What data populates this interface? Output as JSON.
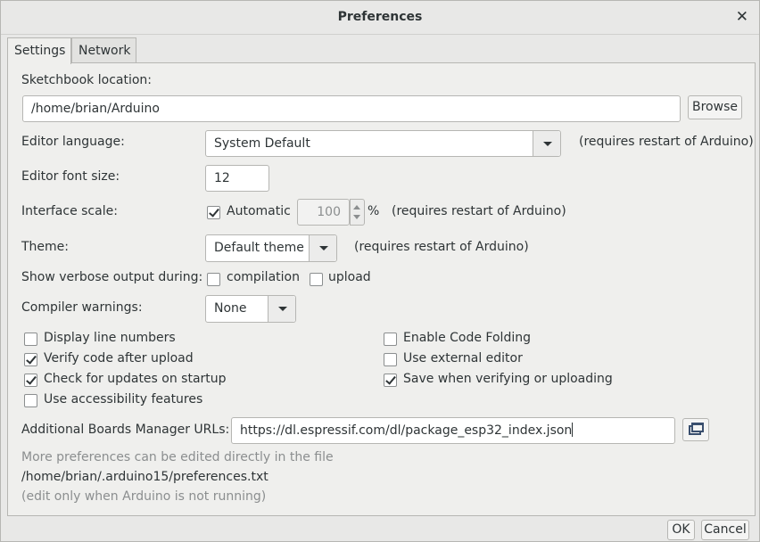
{
  "window": {
    "title": "Preferences"
  },
  "tabs": [
    {
      "label": "Settings",
      "active": true
    },
    {
      "label": "Network",
      "active": false
    }
  ],
  "settings": {
    "sketchbook": {
      "label": "Sketchbook location:",
      "value": "/home/brian/Arduino",
      "browse_label": "Browse"
    },
    "editor_language": {
      "label": "Editor language:",
      "value": "System Default",
      "note": "(requires restart of Arduino)"
    },
    "font_size": {
      "label": "Editor font size:",
      "value": "12"
    },
    "interface_scale": {
      "label": "Interface scale:",
      "automatic_label": "Automatic",
      "automatic_checked": true,
      "value": "100",
      "unit": "%",
      "note": "(requires restart of Arduino)"
    },
    "theme": {
      "label": "Theme:",
      "value": "Default theme",
      "note": "(requires restart of Arduino)"
    },
    "verbose": {
      "label": "Show verbose output during:",
      "compilation_label": "compilation",
      "compilation_checked": false,
      "upload_label": "upload",
      "upload_checked": false
    },
    "compiler_warnings": {
      "label": "Compiler warnings:",
      "value": "None"
    },
    "options_left": [
      {
        "label": "Display line numbers",
        "checked": false
      },
      {
        "label": "Verify code after upload",
        "checked": true
      },
      {
        "label": "Check for updates on startup",
        "checked": true
      },
      {
        "label": "Use accessibility features",
        "checked": false
      }
    ],
    "options_right": [
      {
        "label": "Enable Code Folding",
        "checked": false
      },
      {
        "label": "Use external editor",
        "checked": false
      },
      {
        "label": "Save when verifying or uploading",
        "checked": true
      }
    ],
    "boards_urls": {
      "label": "Additional Boards Manager URLs:",
      "value": "https://dl.espressif.com/dl/package_esp32_index.json"
    },
    "footer": {
      "more_text": "More preferences can be edited directly in the file",
      "path": "/home/brian/.arduino15/preferences.txt",
      "note": "(edit only when Arduino is not running)"
    }
  },
  "buttons": {
    "ok": "OK",
    "cancel": "Cancel"
  }
}
